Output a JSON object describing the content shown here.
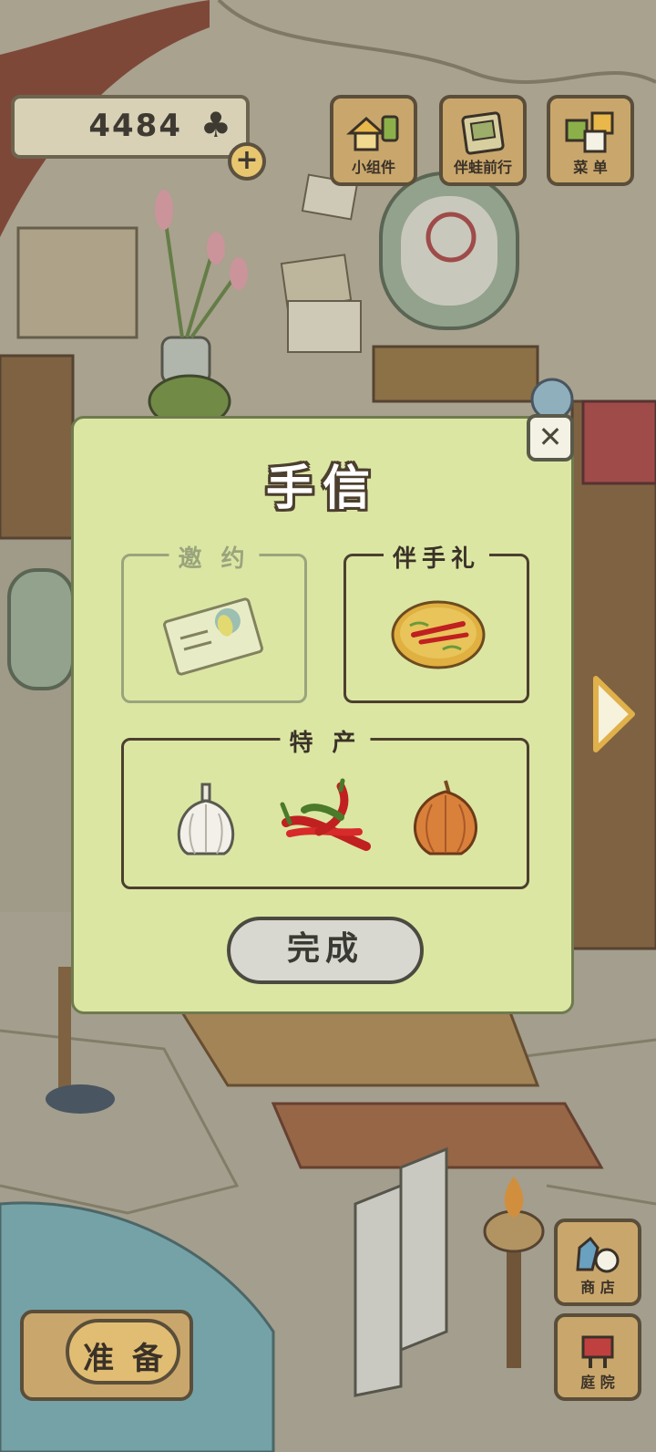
{
  "hud": {
    "clover_count": "4484",
    "clover_icon": "♣",
    "plus_label": "+"
  },
  "top_buttons": [
    {
      "label": "小组件",
      "icon": "widget-icon"
    },
    {
      "label": "伴蛙前行",
      "icon": "journal-icon"
    },
    {
      "label": "菜 单",
      "icon": "menu-icon"
    }
  ],
  "side_buttons": [
    {
      "label": "商 店",
      "icon": "shop-icon"
    },
    {
      "label": "庭 院",
      "icon": "garden-icon"
    }
  ],
  "prepare_button": {
    "label": "准 备"
  },
  "dialog": {
    "title": "手信",
    "close_label": "✕",
    "sections": {
      "invite": {
        "label": "邀 约",
        "item": "invitation-card"
      },
      "gift": {
        "label": "伴手礼",
        "item": "pancake"
      },
      "specialty": {
        "label": "特 产",
        "items": [
          "garlic",
          "chili-peppers",
          "onion"
        ]
      }
    },
    "done_label": "完成"
  }
}
